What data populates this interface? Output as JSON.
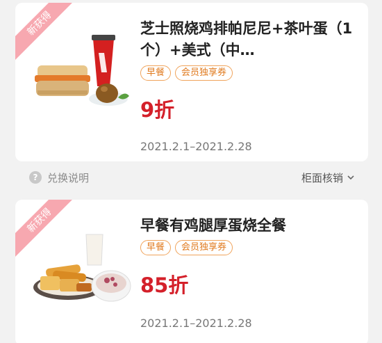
{
  "coupons": [
    {
      "badge": "新获得",
      "title": "芝士照烧鸡排帕尼尼+茶叶蛋（1个）+美式（中…",
      "tags": [
        "早餐",
        "会员独享券"
      ],
      "discount": "9折",
      "validity": "2021.2.1–2021.2.28",
      "image": "breakfast-panini-coffee-egg"
    },
    {
      "badge": "新获得",
      "title": "早餐有鸡腿厚蛋烧全餐",
      "tags": [
        "早餐",
        "会员独享券"
      ],
      "discount": "85折",
      "validity": "2021.2.1–2021.2.28",
      "image": "breakfast-platter-milk-porridge"
    }
  ],
  "infobar": {
    "help_icon": "question-icon",
    "help_label": "兑换说明",
    "redeem_label": "柜面核销",
    "redeem_icon": "chevron-down-icon"
  }
}
